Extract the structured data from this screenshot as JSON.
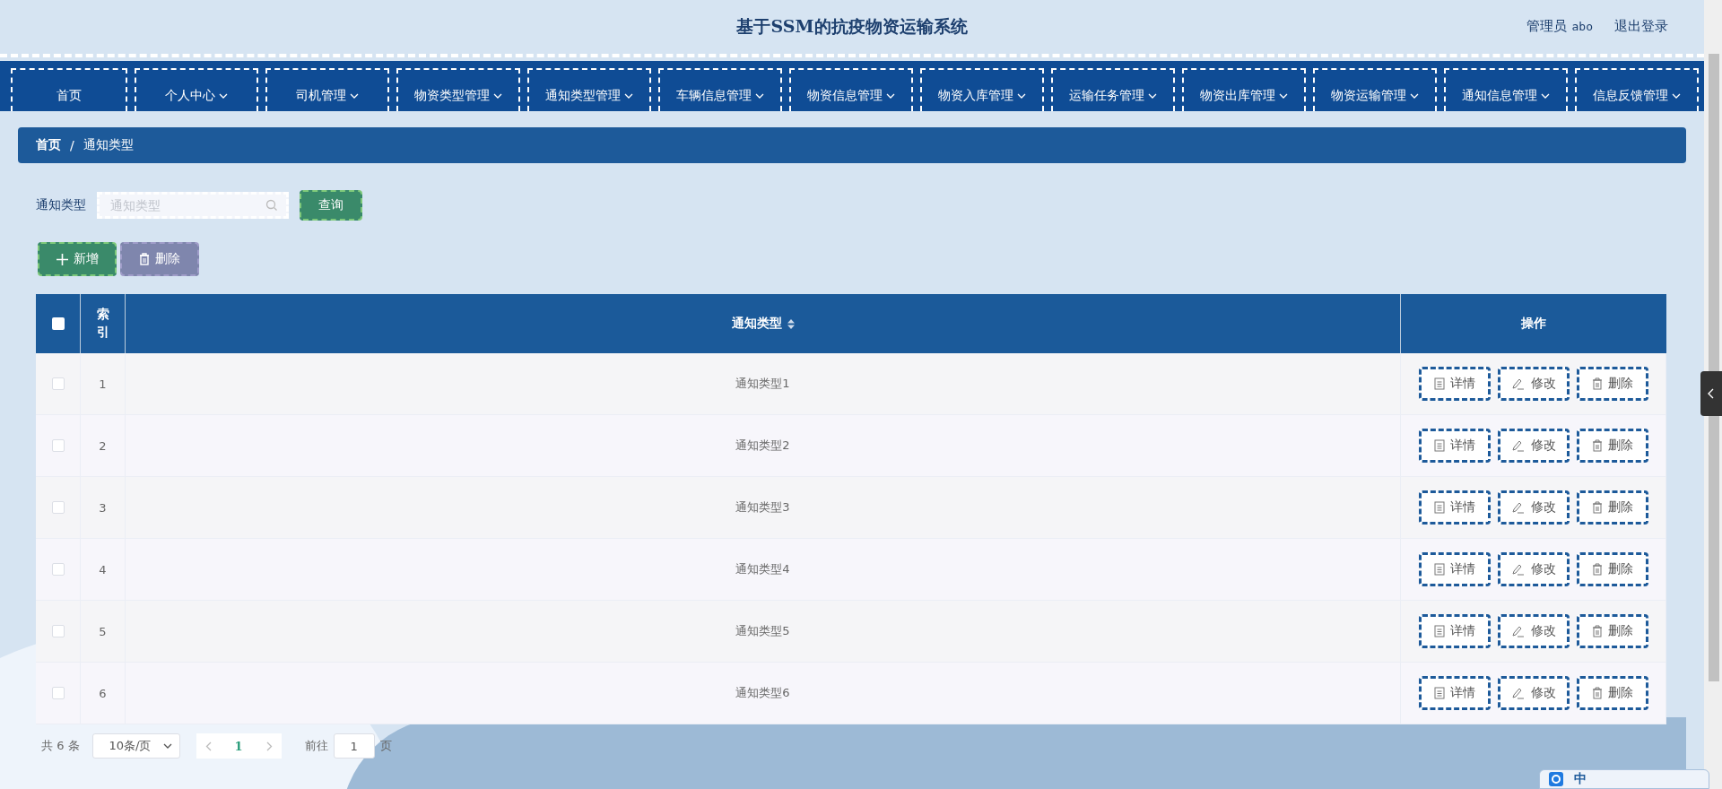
{
  "header": {
    "title": "基于SSM的抗疫物资运输系统",
    "user_role": "管理员",
    "user_name": "abo",
    "logout": "退出登录"
  },
  "nav": [
    {
      "label": "首页",
      "dropdown": false
    },
    {
      "label": "个人中心",
      "dropdown": true
    },
    {
      "label": "司机管理",
      "dropdown": true
    },
    {
      "label": "物资类型管理",
      "dropdown": true
    },
    {
      "label": "通知类型管理",
      "dropdown": true
    },
    {
      "label": "车辆信息管理",
      "dropdown": true
    },
    {
      "label": "物资信息管理",
      "dropdown": true
    },
    {
      "label": "物资入库管理",
      "dropdown": true
    },
    {
      "label": "运输任务管理",
      "dropdown": true
    },
    {
      "label": "物资出库管理",
      "dropdown": true
    },
    {
      "label": "物资运输管理",
      "dropdown": true
    },
    {
      "label": "通知信息管理",
      "dropdown": true
    },
    {
      "label": "信息反馈管理",
      "dropdown": true
    }
  ],
  "breadcrumb": [
    "首页",
    "通知类型"
  ],
  "breadcrumb_separator": "/",
  "search": {
    "label": "通知类型",
    "placeholder": "通知类型",
    "button": "查询"
  },
  "actions": {
    "add": "新增",
    "delete": "删除"
  },
  "table": {
    "columns": {
      "index": "索引",
      "type": "通知类型",
      "actions": "操作"
    },
    "header_checked": false,
    "rows": [
      {
        "index": "1",
        "type": "通知类型1",
        "checked": false,
        "buttons": [
          {
            "kind": "detail",
            "label": "详情"
          },
          {
            "kind": "edit",
            "label": "修改"
          },
          {
            "kind": "delete",
            "label": "删除"
          }
        ]
      },
      {
        "index": "2",
        "type": "通知类型2",
        "checked": false,
        "buttons": [
          {
            "kind": "detail",
            "label": "详情"
          },
          {
            "kind": "edit",
            "label": "修改"
          },
          {
            "kind": "delete",
            "label": "删除"
          }
        ]
      },
      {
        "index": "3",
        "type": "通知类型3",
        "checked": false,
        "buttons": [
          {
            "kind": "detail",
            "label": "详情"
          },
          {
            "kind": "edit",
            "label": "修改"
          },
          {
            "kind": "delete",
            "label": "删除"
          }
        ]
      },
      {
        "index": "4",
        "type": "通知类型4",
        "checked": false,
        "buttons": [
          {
            "kind": "detail",
            "label": "详情"
          },
          {
            "kind": "edit",
            "label": "修改"
          },
          {
            "kind": "delete",
            "label": "删除"
          }
        ]
      },
      {
        "index": "5",
        "type": "通知类型5",
        "checked": false,
        "buttons": [
          {
            "kind": "detail",
            "label": "详情"
          },
          {
            "kind": "edit",
            "label": "修改"
          },
          {
            "kind": "delete",
            "label": "删除"
          }
        ]
      },
      {
        "index": "6",
        "type": "通知类型6",
        "checked": false,
        "buttons": [
          {
            "kind": "detail",
            "label": "详情"
          },
          {
            "kind": "edit",
            "label": "修改"
          },
          {
            "kind": "delete",
            "label": "删除"
          }
        ]
      }
    ]
  },
  "pagination": {
    "total_prefix": "共",
    "total": "6",
    "total_suffix": "条",
    "page_size": "10条/页",
    "pages": [
      {
        "label": "1",
        "selected": true
      }
    ],
    "goto_label": "前往",
    "goto_value": "1",
    "goto_suffix": "页"
  },
  "ime": {
    "mode": "中"
  }
}
